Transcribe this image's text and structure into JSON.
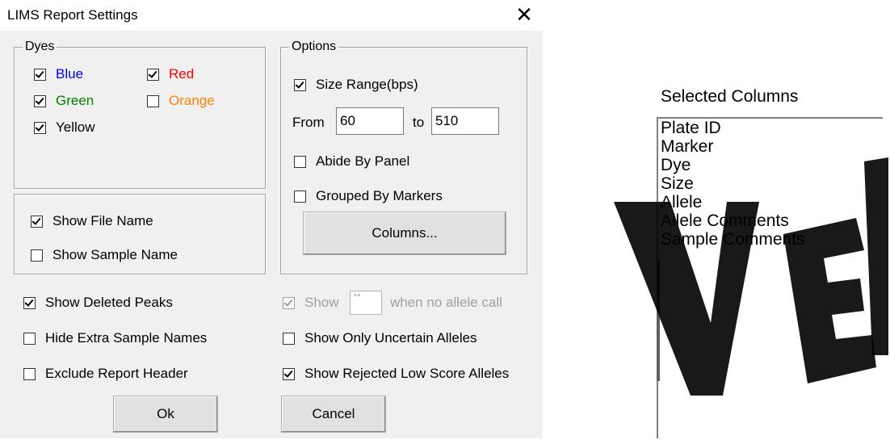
{
  "window": {
    "title": "LIMS Report Settings",
    "close_glyph": "✕"
  },
  "dyes": {
    "legend": "Dyes",
    "items": [
      {
        "label": "Blue",
        "checked": true,
        "color": "#0000ff"
      },
      {
        "label": "Red",
        "checked": true,
        "color": "#ff0000"
      },
      {
        "label": "Green",
        "checked": true,
        "color": "#008000"
      },
      {
        "label": "Orange",
        "checked": false,
        "color": "#ff8000"
      },
      {
        "label": "Yellow",
        "checked": true,
        "color": "#000000"
      }
    ]
  },
  "names": {
    "show_file_name": {
      "label": "Show File Name",
      "checked": true
    },
    "show_sample_name": {
      "label": "Show Sample Name",
      "checked": false
    }
  },
  "options": {
    "legend": "Options",
    "size_range": {
      "label": "Size Range(bps)",
      "checked": true
    },
    "from_label": "From",
    "from_value": "60",
    "to_label": "to",
    "to_value": "510",
    "abide_by_panel": {
      "label": "Abide By Panel",
      "checked": false
    },
    "grouped_by_markers": {
      "label": "Grouped By Markers",
      "checked": false
    },
    "columns_button": "Columns..."
  },
  "bottom": {
    "show_deleted_peaks": {
      "label": "Show Deleted Peaks",
      "checked": true
    },
    "hide_extra_sample_names": {
      "label": "Hide Extra Sample Names",
      "checked": false
    },
    "exclude_report_header": {
      "label": "Exclude Report Header",
      "checked": false
    },
    "show_prefix": {
      "label": "Show",
      "checked": true
    },
    "show_value": "**",
    "show_suffix": "when no allele call",
    "show_only_uncertain": {
      "label": "Show Only Uncertain Alleles",
      "checked": false
    },
    "show_rejected_low_score": {
      "label": "Show Rejected Low Score Alleles",
      "checked": true
    }
  },
  "buttons": {
    "ok": "Ok",
    "cancel": "Cancel"
  },
  "selected_columns": {
    "header": "Selected Columns",
    "items": [
      "Plate ID",
      "Marker",
      "Dye",
      "Size",
      "Allele",
      "Allele Comments",
      "Sample Comments"
    ]
  }
}
